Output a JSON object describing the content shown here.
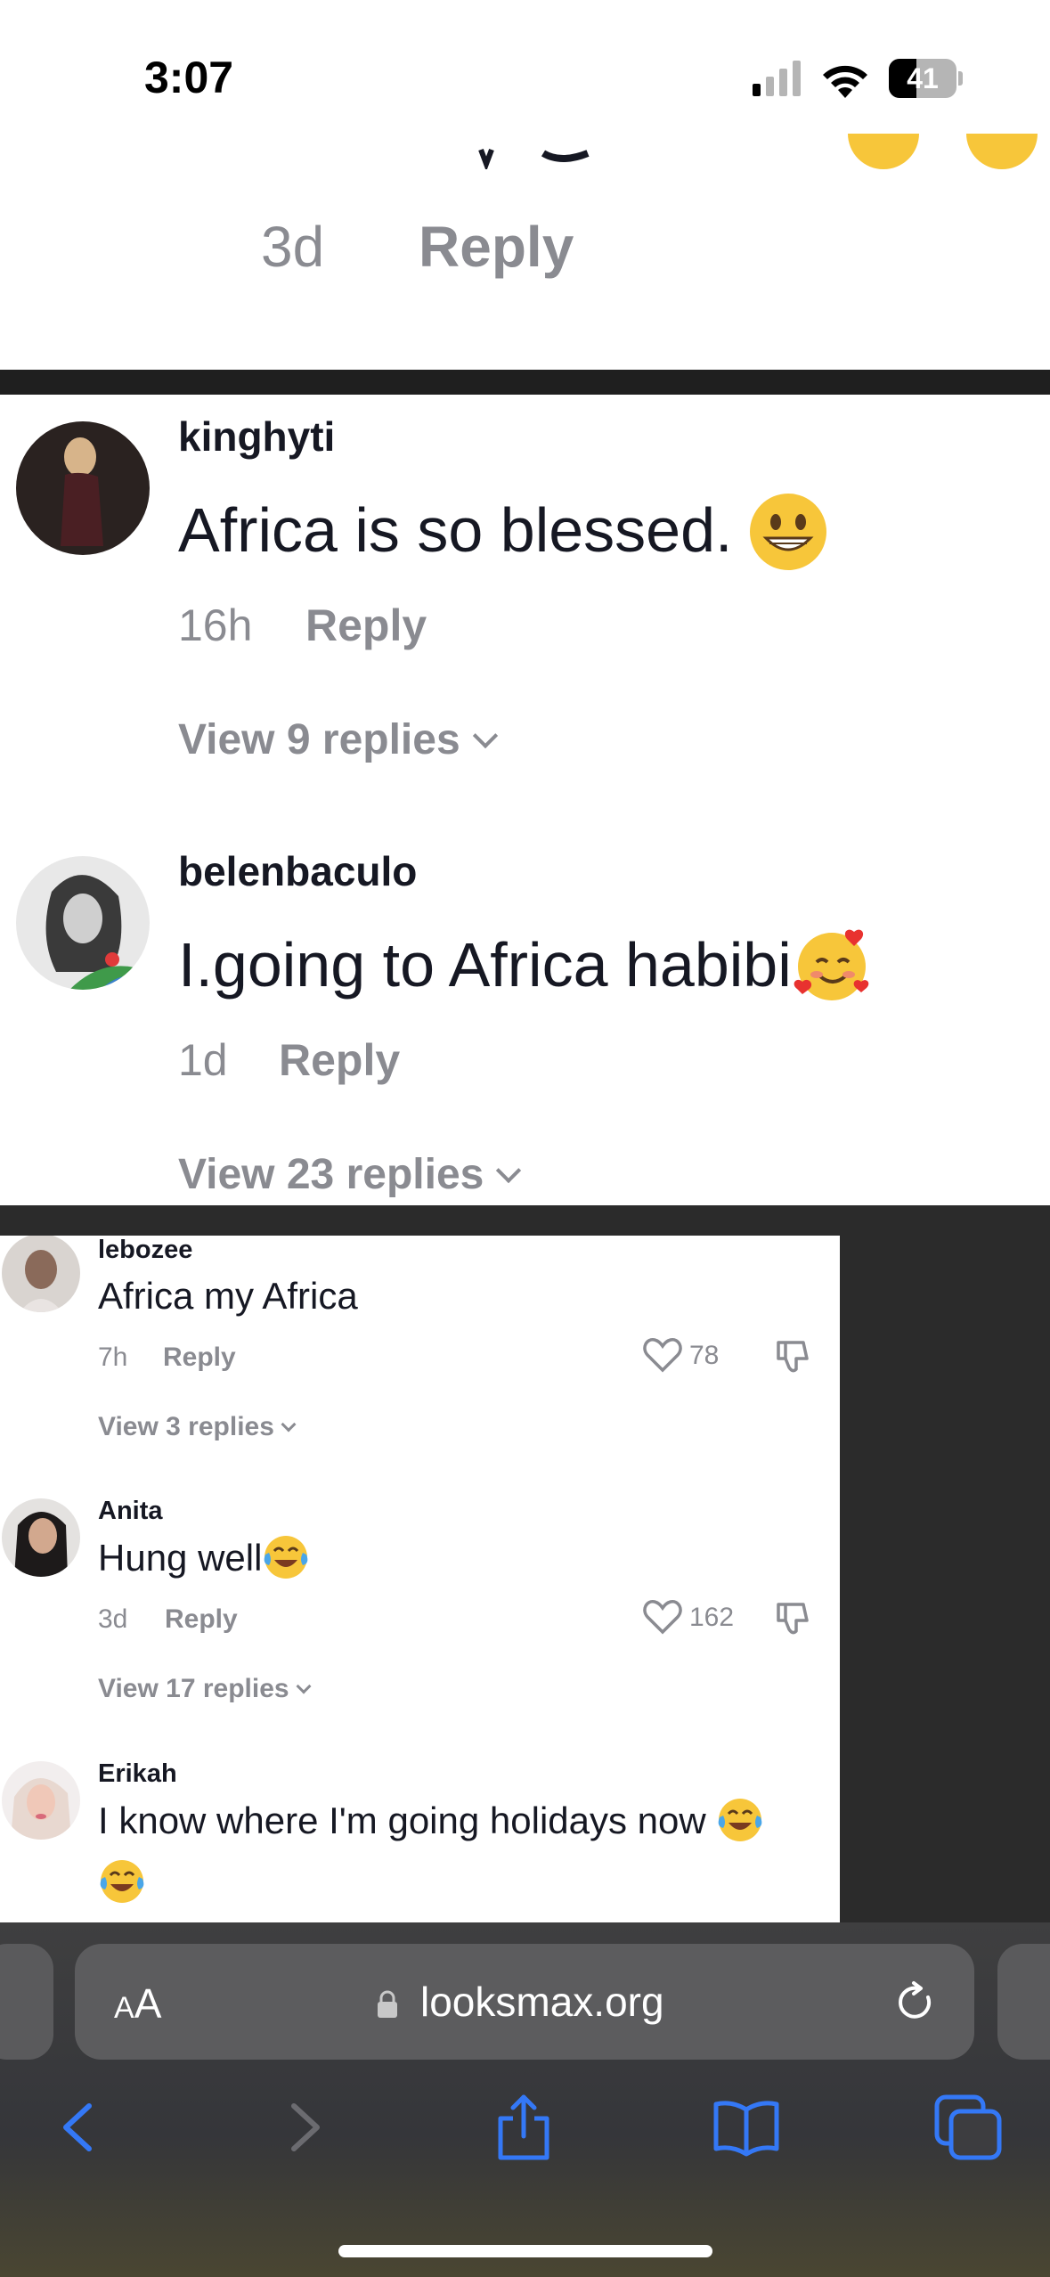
{
  "status_bar": {
    "time": "3:07",
    "battery_level": "41",
    "battery_fraction": 0.41
  },
  "top_fragment": {
    "time": "3d",
    "reply_label": "Reply"
  },
  "big_comments": [
    {
      "username": "kinghyti",
      "text": "Africa is so blessed. ",
      "emoji": "grinning-face",
      "time": "16h",
      "reply_label": "Reply",
      "view_replies": "View 9 replies"
    },
    {
      "username": "belenbaculo",
      "text": "I.going to Africa habibi",
      "emoji": "smiling-face-with-hearts",
      "time": "1d",
      "reply_label": "Reply",
      "view_replies": "View 23 replies"
    }
  ],
  "small_comments": [
    {
      "username": "lebozee",
      "text": "Africa my Africa",
      "time": "7h",
      "reply_label": "Reply",
      "likes": "78",
      "view_replies": "View 3 replies"
    },
    {
      "username": "Anita",
      "text": "Hung well",
      "emoji": "tears-of-joy",
      "time": "3d",
      "reply_label": "Reply",
      "likes": "162",
      "view_replies": "View 17 replies"
    },
    {
      "username": "Erikah",
      "text": "I know where I'm going holidays now ",
      "emoji": "tears-of-joy"
    }
  ],
  "safari": {
    "text_size_label": "AA",
    "url": "looksmax.org",
    "icons": [
      "lock-icon",
      "reload-icon",
      "back-icon",
      "forward-icon",
      "share-icon",
      "bookmarks-icon",
      "tabs-icon"
    ],
    "tint_color": "#3478f6"
  }
}
